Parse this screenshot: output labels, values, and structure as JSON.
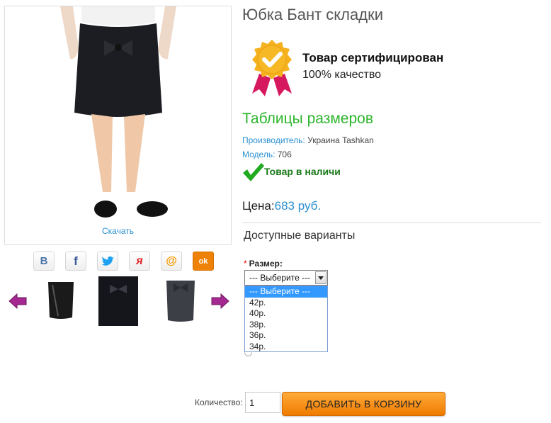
{
  "product": {
    "title": "Юбка Бант складки",
    "download_label": "Скачать"
  },
  "certificate": {
    "title": "Товар сертифицирован",
    "subtitle": "100% качество",
    "badge_icon": "certified-ribbon-icon"
  },
  "sizes_link": "Таблицы размеров",
  "manufacturer": {
    "label": "Производитель:",
    "value": "Украина Tashkan"
  },
  "model": {
    "label": "Модель:",
    "value": "706"
  },
  "stock": {
    "text": "Товар в наличи",
    "icon": "checkmark-icon"
  },
  "price": {
    "label": "Цена:",
    "value": "683 руб."
  },
  "options": {
    "heading": "Доступные варианты",
    "size_label": "Размер:",
    "required_mark": "*",
    "selected": "--- Выберите ---",
    "list": [
      "--- Выберите ---",
      "42р.",
      "40р.",
      "38р.",
      "36р.",
      "34р."
    ]
  },
  "social": [
    {
      "icon": "vk-icon",
      "glyph": "В",
      "color": "#4a76a8"
    },
    {
      "icon": "facebook-icon",
      "glyph": "f",
      "color": "#3b5998"
    },
    {
      "icon": "twitter-icon",
      "glyph": "",
      "color": "#1da1f2"
    },
    {
      "icon": "yaru-icon",
      "glyph": "я",
      "color": "#e0262a"
    },
    {
      "icon": "mailru-icon",
      "glyph": "@",
      "color": "#f59a00"
    },
    {
      "icon": "odnoklassniki-icon",
      "glyph": "ok",
      "color": "#ee8208"
    }
  ],
  "gallery": {
    "prev_icon": "arrow-left-icon",
    "next_icon": "arrow-right-icon",
    "thumbs": [
      "black-satin-skirt",
      "black-bow-skirt",
      "gray-bow-skirt"
    ]
  },
  "quantity": {
    "label": "Количество:",
    "value": "1"
  },
  "cart_button": "ДОБАВИТЬ В КОРЗИНУ",
  "colors": {
    "accent_blue": "#2a8fd0",
    "accent_green": "#2cb52c",
    "button_orange": "#f07b00",
    "select_highlight": "#3399ff"
  }
}
